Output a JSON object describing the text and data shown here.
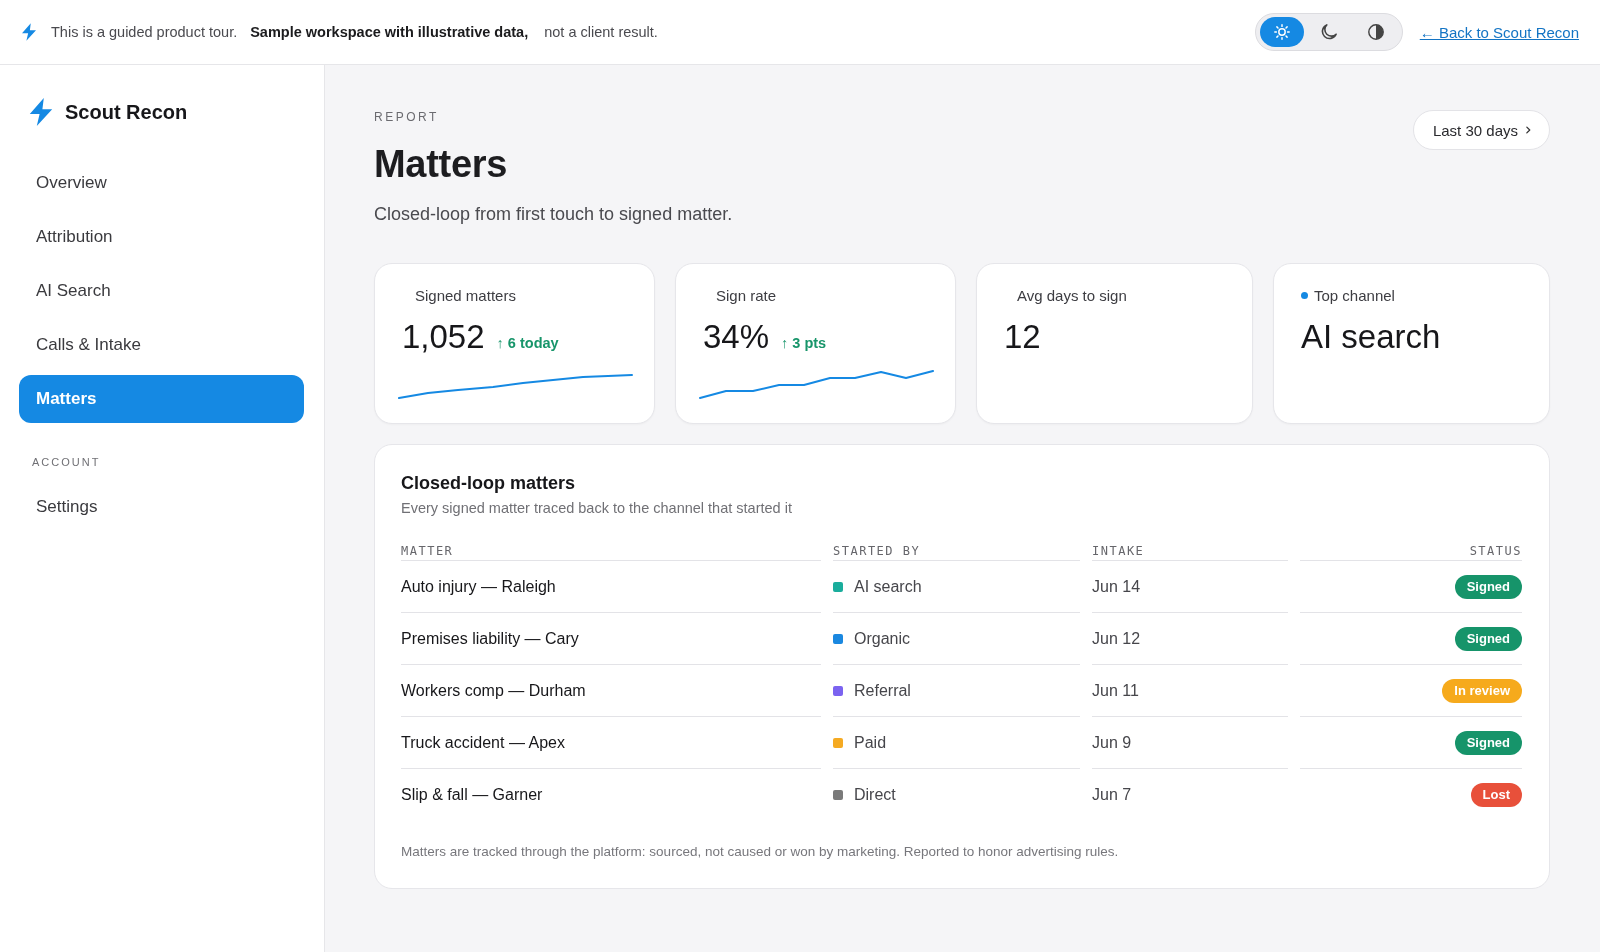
{
  "banner": {
    "intro": "This is a guided product tour.",
    "emphasis": "Sample workspace with illustrative data,",
    "note": "not a client result."
  },
  "theme_switcher": [
    {
      "kind": "light",
      "selected": true
    },
    {
      "kind": "dark",
      "selected": false
    },
    {
      "kind": "contrast",
      "selected": false
    }
  ],
  "back_link": "← Back to Scout Recon",
  "sidebar": {
    "brand": "Scout Recon",
    "groups": [
      {
        "items": [
          {
            "label": "Overview",
            "selected": false
          },
          {
            "label": "Attribution",
            "selected": false
          },
          {
            "label": "AI Search",
            "selected": false
          },
          {
            "label": "Calls & Intake",
            "selected": false
          },
          {
            "label": "Matters",
            "selected": true
          }
        ]
      },
      {
        "heading": "ACCOUNT",
        "items": [
          {
            "label": "Settings",
            "selected": false
          }
        ]
      }
    ]
  },
  "header": {
    "eyebrow": "REPORT",
    "title": "Matters",
    "subtitle": "Closed-loop from first touch to signed matter.",
    "range_button": "Last 30 days"
  },
  "kpis": [
    {
      "kind": "smooth",
      "label": "Signed matters",
      "value": "1,052",
      "delta": "↑ 6 today",
      "dot": false
    },
    {
      "kind": "stepped",
      "label": "Sign rate",
      "value": "34%",
      "delta": "↑ 3 pts",
      "dot": false
    },
    {
      "kind": "plain",
      "label": "Avg days to sign",
      "value": "12",
      "dot": false
    },
    {
      "kind": "plain",
      "label": "Top channel",
      "value": "AI search",
      "dot": true
    }
  ],
  "table": {
    "title": "Closed-loop matters",
    "subtitle": "Every signed matter traced back to the channel that started it",
    "columns": [
      "MATTER",
      "STARTED BY",
      "INTAKE",
      "STATUS"
    ],
    "rows": [
      {
        "matter": "Auto injury — Raleigh",
        "started_by": {
          "label": "AI search",
          "color": "#1aad9c"
        },
        "intake": "Jun 14",
        "status": {
          "label": "Signed",
          "kind": "signed"
        }
      },
      {
        "matter": "Premises liability — Cary",
        "started_by": {
          "label": "Organic",
          "color": "#1a88e0"
        },
        "intake": "Jun 12",
        "status": {
          "label": "Signed",
          "kind": "signed"
        }
      },
      {
        "matter": "Workers comp — Durham",
        "started_by": {
          "label": "Referral",
          "color": "#7b63f0"
        },
        "intake": "Jun 11",
        "status": {
          "label": "In review",
          "kind": "review"
        }
      },
      {
        "matter": "Truck accident — Apex",
        "started_by": {
          "label": "Paid",
          "color": "#f5aa22"
        },
        "intake": "Jun 9",
        "status": {
          "label": "Signed",
          "kind": "signed"
        }
      },
      {
        "matter": "Slip & fall — Garner",
        "started_by": {
          "label": "Direct",
          "color": "#7a7a7a"
        },
        "intake": "Jun 7",
        "status": {
          "label": "Lost",
          "kind": "lost"
        }
      }
    ],
    "footnote": "Matters are tracked through the platform: sourced, not caused or won by marketing. Reported to honor advertising rules."
  }
}
